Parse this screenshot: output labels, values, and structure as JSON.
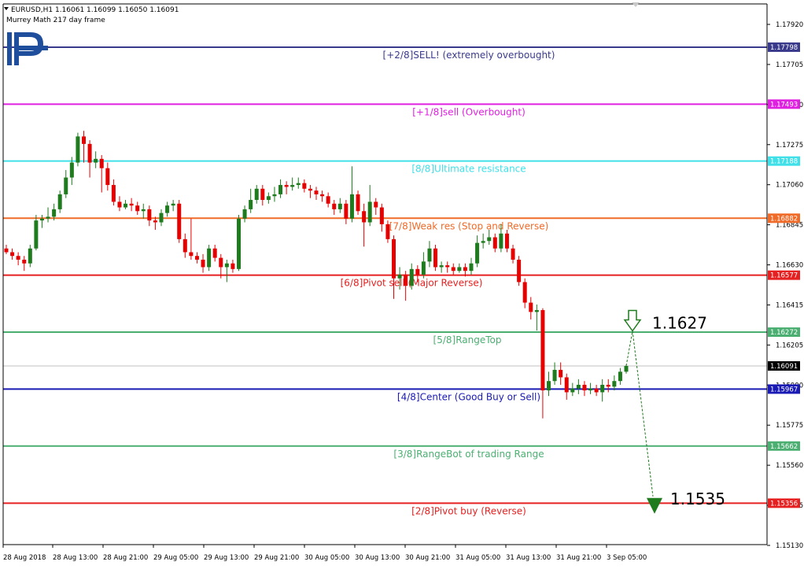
{
  "header": {
    "symbol_line": "EURUSD,H1  1.16061 1.16099 1.16050 1.16091",
    "indicator_line": "Murrey Math 217 day frame"
  },
  "colors": {
    "bull": "#1e7b1e",
    "bear": "#e60000",
    "forecast": "#1e7b1e",
    "axis": "#000000"
  },
  "chart_data": {
    "type": "candlestick",
    "symbol": "EURUSD",
    "timeframe": "H1",
    "y_range": [
      1.1513,
      1.18
    ],
    "y_ticks": [
      "1.17920",
      "1.17705",
      "1.17490",
      "1.17275",
      "1.17060",
      "1.16845",
      "1.16630",
      "1.16415",
      "1.16205",
      "1.15990",
      "1.15775",
      "1.15560",
      "1.15345",
      "1.15130"
    ],
    "x_labels": [
      "28 Aug 2018",
      "28 Aug 13:00",
      "28 Aug 21:00",
      "29 Aug 05:00",
      "29 Aug 13:00",
      "29 Aug 21:00",
      "30 Aug 05:00",
      "30 Aug 13:00",
      "30 Aug 21:00",
      "31 Aug 05:00",
      "31 Aug 13:00",
      "31 Aug 21:00",
      "3 Sep 05:00"
    ],
    "current_price": {
      "value": 1.16091,
      "label": "1.16091"
    },
    "murrey_levels": [
      {
        "value": 1.17798,
        "price_label": "1.17798",
        "text": "[+2/8]SELL! (extremely overbought)",
        "color": "#3a3a8c"
      },
      {
        "value": 1.17493,
        "price_label": "1.17493",
        "text": "[+1/8]sell (Overbought)",
        "color": "#e020e0"
      },
      {
        "value": 1.17188,
        "price_label": "1.17188",
        "text": "[8/8]Ultimate resistance",
        "color": "#40e0e8"
      },
      {
        "value": 1.16882,
        "price_label": "1.16882",
        "text": "[7/8]Weak res (Stop and Reverse)",
        "color": "#f06a28"
      },
      {
        "value": 1.16577,
        "price_label": "1.16577",
        "text": "[6/8]Pivot sell (Major Reverse)",
        "color": "#e62020"
      },
      {
        "value": 1.16272,
        "price_label": "1.16272",
        "text": "[5/8]RangeTop",
        "color": "#4caf72"
      },
      {
        "value": 1.15967,
        "price_label": "1.15967",
        "text": "[4/8]Center (Good Buy or Sell)",
        "color": "#1a1ab4"
      },
      {
        "value": 1.15662,
        "price_label": "1.15662",
        "text": "[3/8]RangeBot of trading Range",
        "color": "#4caf72"
      },
      {
        "value": 1.15356,
        "price_label": "1.15356",
        "text": "[2/8]Pivot buy (Reverse)",
        "color": "#e62020"
      }
    ],
    "annotations": [
      {
        "id": "target_up",
        "value": 1.1627,
        "label": "1.1627",
        "arrow": "down-hollow"
      },
      {
        "id": "target_down",
        "value": 1.1535,
        "label": "1.1535",
        "arrow": "down-filled"
      }
    ],
    "candles": [
      [
        1.1672,
        1.167,
        1.1674,
        1.1669
      ],
      [
        1.167,
        1.1668,
        1.1672,
        1.1666
      ],
      [
        1.1668,
        1.1666,
        1.167,
        1.1663
      ],
      [
        1.1666,
        1.1664,
        1.1668,
        1.166
      ],
      [
        1.1664,
        1.1672,
        1.1674,
        1.1662
      ],
      [
        1.1672,
        1.1687,
        1.169,
        1.1671
      ],
      [
        1.1687,
        1.1688,
        1.169,
        1.1683
      ],
      [
        1.1688,
        1.1689,
        1.1694,
        1.1686
      ],
      [
        1.1689,
        1.1693,
        1.1696,
        1.1687
      ],
      [
        1.1693,
        1.1701,
        1.1703,
        1.1691
      ],
      [
        1.1701,
        1.171,
        1.1714,
        1.1699
      ],
      [
        1.171,
        1.1718,
        1.1721,
        1.1706
      ],
      [
        1.1718,
        1.1732,
        1.1734,
        1.1716
      ],
      [
        1.1732,
        1.1728,
        1.1735,
        1.1718
      ],
      [
        1.1728,
        1.1718,
        1.173,
        1.171
      ],
      [
        1.1718,
        1.172,
        1.1724,
        1.1715
      ],
      [
        1.172,
        1.1715,
        1.1722,
        1.1702
      ],
      [
        1.1715,
        1.1706,
        1.1718,
        1.1703
      ],
      [
        1.1706,
        1.1697,
        1.1709,
        1.1695
      ],
      [
        1.1697,
        1.1694,
        1.17,
        1.1692
      ],
      [
        1.1694,
        1.1696,
        1.1698,
        1.1693
      ],
      [
        1.1696,
        1.1695,
        1.1699,
        1.1692
      ],
      [
        1.1695,
        1.1692,
        1.1697,
        1.169
      ],
      [
        1.1692,
        1.1693,
        1.1696,
        1.1688
      ],
      [
        1.1693,
        1.1687,
        1.1695,
        1.1684
      ],
      [
        1.1687,
        1.1686,
        1.1689,
        1.1682
      ],
      [
        1.1686,
        1.1691,
        1.1693,
        1.1684
      ],
      [
        1.1691,
        1.1695,
        1.1697,
        1.1689
      ],
      [
        1.1695,
        1.1696,
        1.1698,
        1.1692
      ],
      [
        1.1696,
        1.1677,
        1.1698,
        1.1675
      ],
      [
        1.1677,
        1.167,
        1.168,
        1.1667
      ],
      [
        1.167,
        1.1668,
        1.1688,
        1.1666
      ],
      [
        1.1668,
        1.1666,
        1.167,
        1.1664
      ],
      [
        1.1666,
        1.1662,
        1.1669,
        1.1659
      ],
      [
        1.1662,
        1.1672,
        1.1674,
        1.166
      ],
      [
        1.1672,
        1.1667,
        1.1674,
        1.1665
      ],
      [
        1.1667,
        1.1662,
        1.1669,
        1.1656
      ],
      [
        1.1662,
        1.1664,
        1.1666,
        1.1654
      ],
      [
        1.1664,
        1.1661,
        1.1666,
        1.1659
      ],
      [
        1.1661,
        1.1688,
        1.169,
        1.166
      ],
      [
        1.1688,
        1.1693,
        1.1695,
        1.1686
      ],
      [
        1.1693,
        1.1698,
        1.1704,
        1.1691
      ],
      [
        1.1698,
        1.1704,
        1.1706,
        1.1696
      ],
      [
        1.1704,
        1.1698,
        1.1706,
        1.1695
      ],
      [
        1.1698,
        1.17,
        1.1702,
        1.1696
      ],
      [
        1.17,
        1.1701,
        1.1705,
        1.1697
      ],
      [
        1.1701,
        1.1706,
        1.1709,
        1.1699
      ],
      [
        1.1706,
        1.1705,
        1.1708,
        1.1701
      ],
      [
        1.1705,
        1.1706,
        1.171,
        1.1703
      ],
      [
        1.1706,
        1.1707,
        1.171,
        1.1704
      ],
      [
        1.1707,
        1.1704,
        1.1709,
        1.1702
      ],
      [
        1.1704,
        1.1703,
        1.1706,
        1.1699
      ],
      [
        1.1703,
        1.1701,
        1.1705,
        1.1698
      ],
      [
        1.1701,
        1.17,
        1.1703,
        1.1697
      ],
      [
        1.17,
        1.1696,
        1.1702,
        1.1694
      ],
      [
        1.1696,
        1.1693,
        1.1698,
        1.169
      ],
      [
        1.1693,
        1.1696,
        1.1699,
        1.1691
      ],
      [
        1.1696,
        1.1688,
        1.1698,
        1.1685
      ],
      [
        1.1688,
        1.1701,
        1.1716,
        1.1686
      ],
      [
        1.1701,
        1.1692,
        1.1703,
        1.169
      ],
      [
        1.1692,
        1.1686,
        1.1696,
        1.1673
      ],
      [
        1.1686,
        1.1697,
        1.1706,
        1.1684
      ],
      [
        1.1697,
        1.1694,
        1.1699,
        1.169
      ],
      [
        1.1694,
        1.1685,
        1.1696,
        1.1681
      ],
      [
        1.1685,
        1.1677,
        1.1687,
        1.1675
      ],
      [
        1.1677,
        1.1656,
        1.1679,
        1.1645
      ],
      [
        1.1656,
        1.1658,
        1.1662,
        1.165
      ],
      [
        1.1658,
        1.1652,
        1.166,
        1.1644
      ],
      [
        1.1652,
        1.1661,
        1.1664,
        1.165
      ],
      [
        1.1661,
        1.1658,
        1.1663,
        1.1654
      ],
      [
        1.1658,
        1.1665,
        1.167,
        1.1656
      ],
      [
        1.1665,
        1.1672,
        1.1676,
        1.1662
      ],
      [
        1.1672,
        1.1662,
        1.1674,
        1.166
      ],
      [
        1.1662,
        1.1663,
        1.1665,
        1.1659
      ],
      [
        1.1663,
        1.1662,
        1.1665,
        1.1659
      ],
      [
        1.1662,
        1.166,
        1.1664,
        1.1658
      ],
      [
        1.166,
        1.1662,
        1.1664,
        1.1659
      ],
      [
        1.1662,
        1.166,
        1.1664,
        1.1657
      ],
      [
        1.166,
        1.1664,
        1.1667,
        1.1658
      ],
      [
        1.1664,
        1.1675,
        1.1679,
        1.1662
      ],
      [
        1.1675,
        1.1676,
        1.168,
        1.1672
      ],
      [
        1.1676,
        1.1678,
        1.1682,
        1.1674
      ],
      [
        1.1678,
        1.1672,
        1.168,
        1.167
      ],
      [
        1.1672,
        1.168,
        1.1685,
        1.167
      ],
      [
        1.168,
        1.1672,
        1.1682,
        1.167
      ],
      [
        1.1672,
        1.1666,
        1.1674,
        1.1664
      ],
      [
        1.1666,
        1.1654,
        1.1668,
        1.1652
      ],
      [
        1.1654,
        1.1643,
        1.1656,
        1.164
      ],
      [
        1.1643,
        1.1638,
        1.1646,
        1.1634
      ],
      [
        1.1638,
        1.1639,
        1.1642,
        1.1628
      ],
      [
        1.1639,
        1.1596,
        1.164,
        1.1581
      ],
      [
        1.1596,
        1.1601,
        1.1606,
        1.1593
      ],
      [
        1.1601,
        1.1607,
        1.1611,
        1.1599
      ],
      [
        1.1607,
        1.1603,
        1.1611,
        1.1599
      ],
      [
        1.1603,
        1.1595,
        1.1605,
        1.1591
      ],
      [
        1.1595,
        1.1597,
        1.16,
        1.1593
      ],
      [
        1.1597,
        1.1599,
        1.1602,
        1.1594
      ],
      [
        1.1599,
        1.1596,
        1.1601,
        1.1593
      ],
      [
        1.1596,
        1.1597,
        1.16,
        1.1594
      ],
      [
        1.1597,
        1.1595,
        1.1599,
        1.1593
      ],
      [
        1.1595,
        1.1599,
        1.1602,
        1.159
      ],
      [
        1.1599,
        1.1598,
        1.1602,
        1.1595
      ],
      [
        1.1598,
        1.1601,
        1.1604,
        1.1596
      ],
      [
        1.1601,
        1.1606,
        1.1608,
        1.1599
      ],
      [
        1.1606,
        1.16091,
        1.16099,
        1.1605
      ]
    ]
  }
}
